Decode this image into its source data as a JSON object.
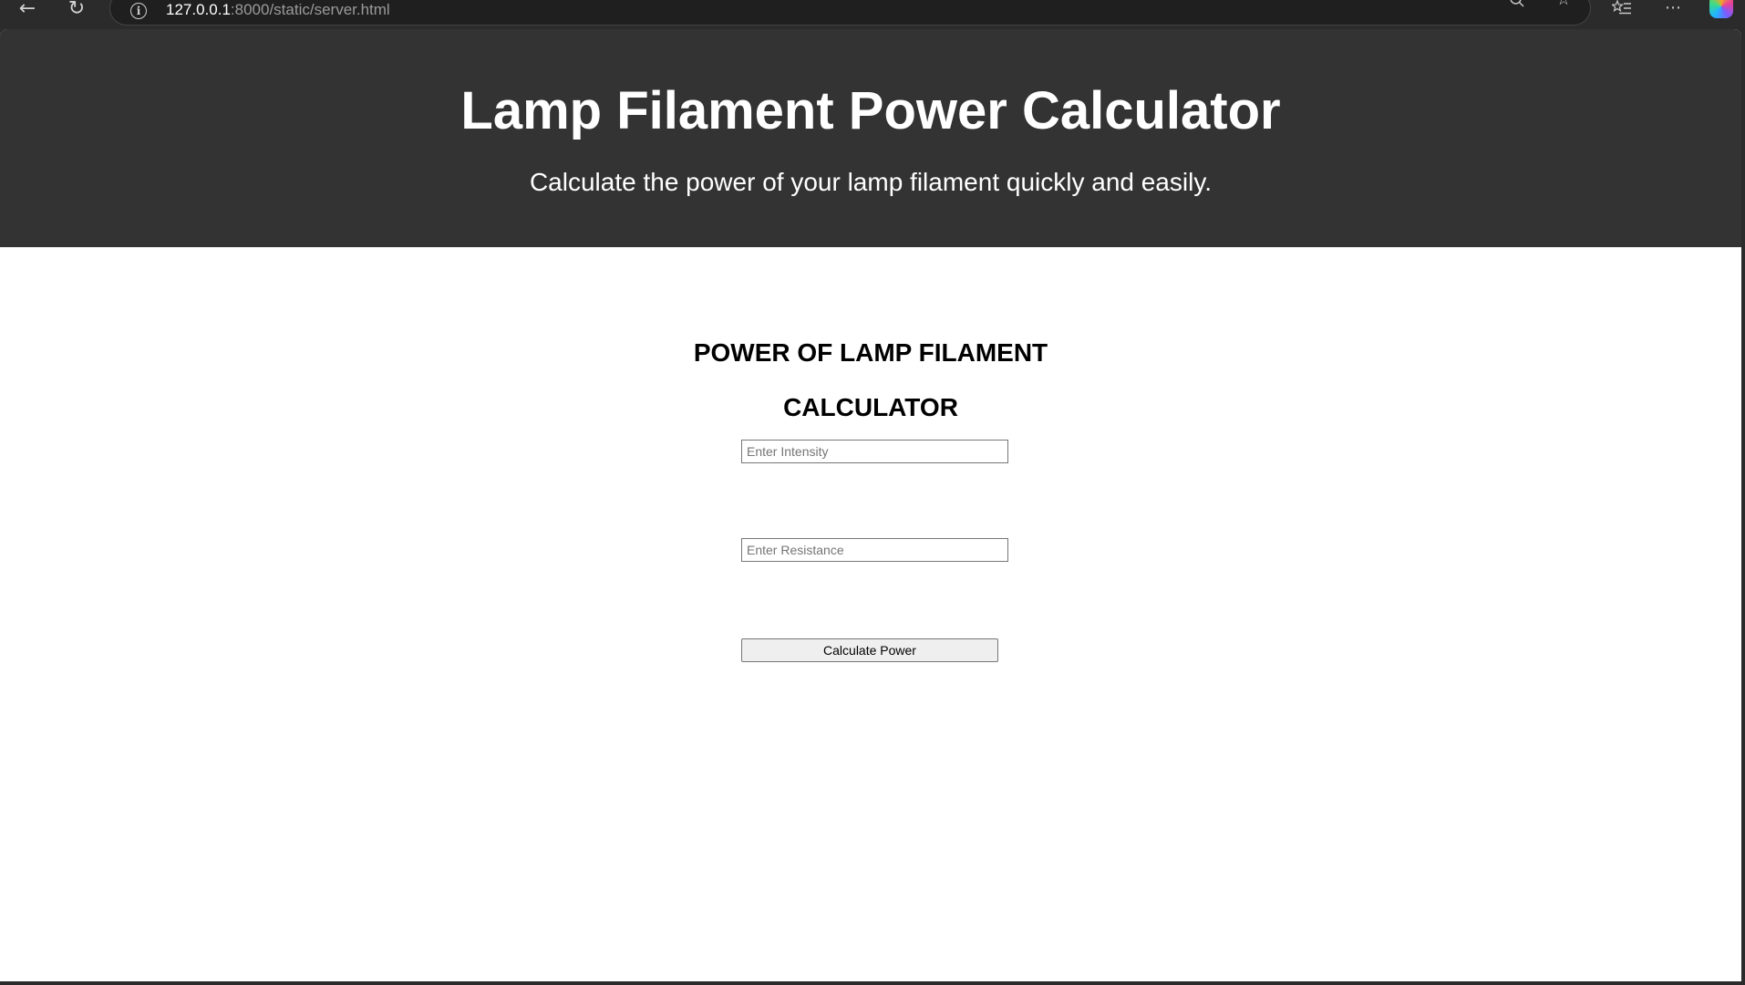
{
  "browser": {
    "url_host": "127.0.0.1",
    "url_rest": ":8000/static/server.html",
    "icons": [
      "back-icon",
      "refresh-icon",
      "info-icon",
      "zoom-out-icon",
      "favorite-star-icon",
      "favorites-list-icon",
      "more-options-icon",
      "copilot-icon"
    ]
  },
  "header": {
    "title": "Lamp Filament Power Calculator",
    "subtitle": "Calculate the power of your lamp filament quickly and easily."
  },
  "calculator": {
    "title_line1": "POWER OF LAMP FILAMENT",
    "title_line2": "CALCULATOR",
    "intensity_placeholder": "Enter Intensity",
    "intensity_value": "",
    "resistance_placeholder": "Enter Resistance",
    "resistance_value": "",
    "button_label": "Calculate Power"
  },
  "colors": {
    "header_bg": "#333333",
    "page_bg": "#ffffff",
    "chrome_bg": "#2b2b2b"
  }
}
